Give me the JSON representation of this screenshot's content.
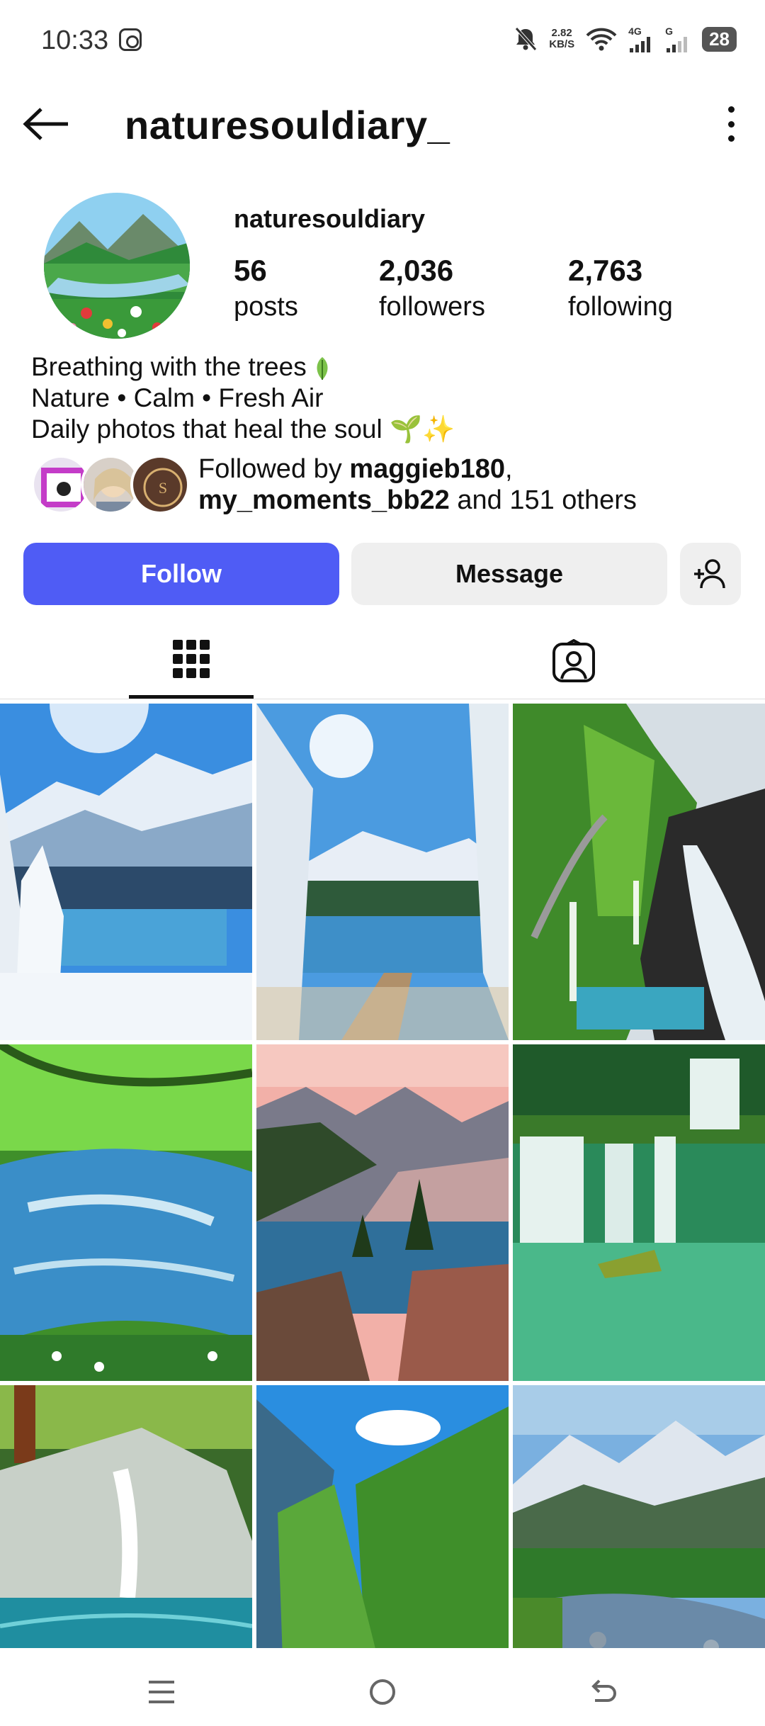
{
  "status_bar": {
    "time": "10:33",
    "net_speed_value": "2.82",
    "net_speed_unit": "KB/S",
    "signal1_label": "4G",
    "signal2_label": "G",
    "battery": "28"
  },
  "header": {
    "username": "naturesouldiary_"
  },
  "profile": {
    "display_name": "naturesouldiary",
    "posts_count": "56",
    "posts_label": "posts",
    "followers_count": "2,036",
    "followers_label": "followers",
    "following_count": "2,763",
    "following_label": "following"
  },
  "bio": {
    "line1": "Breathing with the trees",
    "line2": "Nature • Calm • Fresh Air",
    "line3": "Daily photos that heal the soul",
    "line3_emoji": "🌱✨"
  },
  "followed_by": {
    "prefix": "Followed by ",
    "user1": "maggieb180",
    "sep": ",",
    "user2": "my_moments_bb22",
    "suffix": " and 151 others"
  },
  "actions": {
    "follow_label": "Follow",
    "message_label": "Message"
  },
  "colors": {
    "accent": "#4f5cf5",
    "secondary_button": "#efefef"
  },
  "icons": {
    "back": "arrow-left-icon",
    "more": "vertical-dots-icon",
    "suggest": "add-person-icon",
    "grid_tab": "grid-icon",
    "tagged_tab": "tagged-person-icon",
    "nav_menu": "menu-icon",
    "nav_home": "home-circle-icon",
    "nav_back": "back-icon"
  },
  "posts": [
    {
      "name": "snowy-mountain-lake"
    },
    {
      "name": "winter-sun-lake-path"
    },
    {
      "name": "coastal-road-waterfall"
    },
    {
      "name": "forest-stream"
    },
    {
      "name": "sunset-mountain-lake"
    },
    {
      "name": "green-lake-waterfalls"
    },
    {
      "name": "forest-waterfall-pool"
    },
    {
      "name": "mountain-valley-river"
    },
    {
      "name": "alpine-rocky-stream"
    }
  ]
}
